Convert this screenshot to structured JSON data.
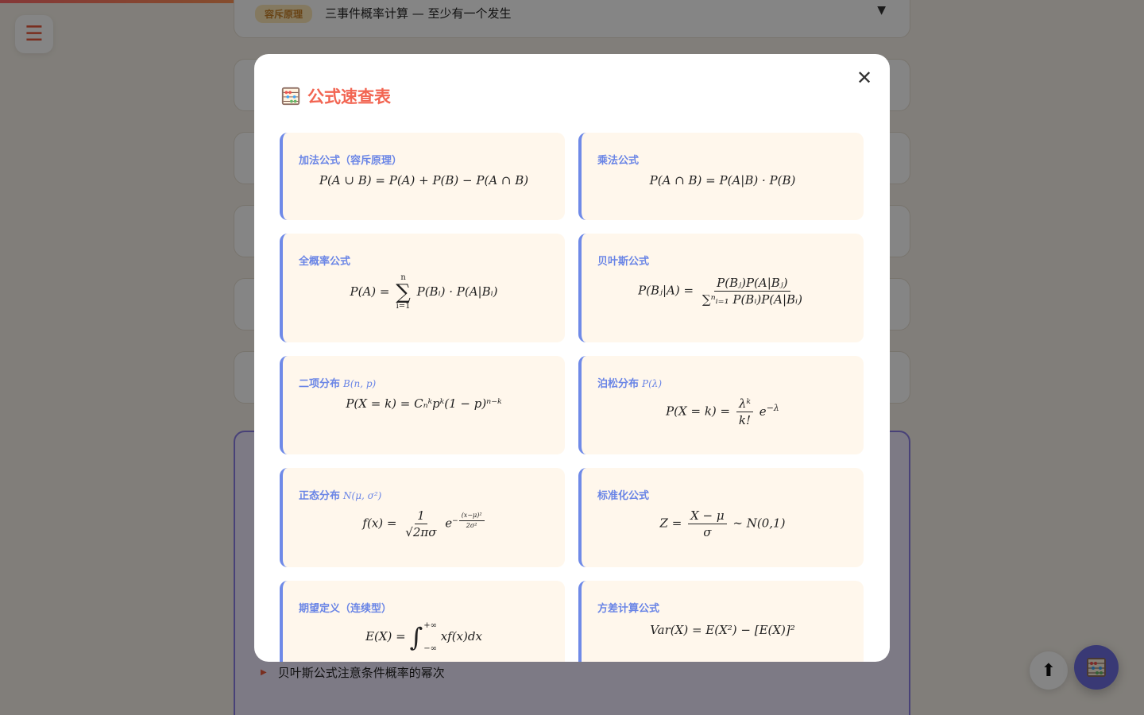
{
  "background": {
    "topic": {
      "tag": "容斥原理",
      "title": "三事件概率计算 — 至少有一个发生"
    },
    "menu_icon": "hamburger-icon",
    "tip_text": "贝叶斯公式注意条件概率的幂次",
    "top_icon": "arrow-up-icon",
    "fab_icon": "abacus-icon",
    "colors": {
      "accent": "#f26552",
      "card_border": "#6f8ae8",
      "card_bg": "#fff7ec",
      "fab": "#6d6ee0"
    }
  },
  "modal": {
    "icon": "abacus-icon",
    "title": "公式速查表",
    "close_label": "✕",
    "cards": [
      {
        "title": "加法公式（容斥原理）",
        "subtitle": ""
      },
      {
        "title": "乘法公式",
        "subtitle": ""
      },
      {
        "title": "全概率公式",
        "subtitle": ""
      },
      {
        "title": "贝叶斯公式",
        "subtitle": ""
      },
      {
        "title": "二项分布",
        "subtitle": "B(n, p)"
      },
      {
        "title": "泊松分布",
        "subtitle": "P(λ)"
      },
      {
        "title": "正态分布",
        "subtitle": "N(μ, σ²)"
      },
      {
        "title": "标准化公式",
        "subtitle": ""
      },
      {
        "title": "期望定义（连续型）",
        "subtitle": ""
      },
      {
        "title": "方差计算公式",
        "subtitle": ""
      }
    ],
    "formulas": {
      "addition": "P(A ∪ B) = P(A) + P(B) − P(A ∩ B)",
      "multiplication": "P(A ∩ B) = P(A|B) · P(B)",
      "total_lhs": "P(A) =",
      "total_sum_top": "n",
      "total_sum_bottom": "i=1",
      "total_rhs": "P(Bᵢ) · P(A|Bᵢ)",
      "bayes_lhs": "P(Bⱼ|A) =",
      "bayes_num": "P(Bⱼ)P(A|Bⱼ)",
      "bayes_den": "∑ⁿᵢ₌₁ P(Bᵢ)P(A|Bᵢ)",
      "binomial": "P(X = k) = Cₙᵏpᵏ(1 − p)ⁿ⁻ᵏ",
      "poisson_lhs": "P(X = k) =",
      "poisson_num": "λᵏ",
      "poisson_den": "k!",
      "poisson_tail": "e⁻ᵠ",
      "normal_lhs": "f(x) =",
      "normal_num": "1",
      "normal_den": "√2πσ",
      "normal_exp_num": "(x−μ)²",
      "normal_exp_den": "2σ²",
      "standard_lhs": "Z =",
      "standard_num": "X − μ",
      "standard_den": "σ",
      "standard_rhs": "∼ N(0,1)",
      "expect_lhs": "E(X) =",
      "expect_top": "+∞",
      "expect_bottom": "−∞",
      "expect_rhs": "xf(x)dx",
      "variance": "Var(X) = E(X²) − [E(X)]²"
    }
  }
}
